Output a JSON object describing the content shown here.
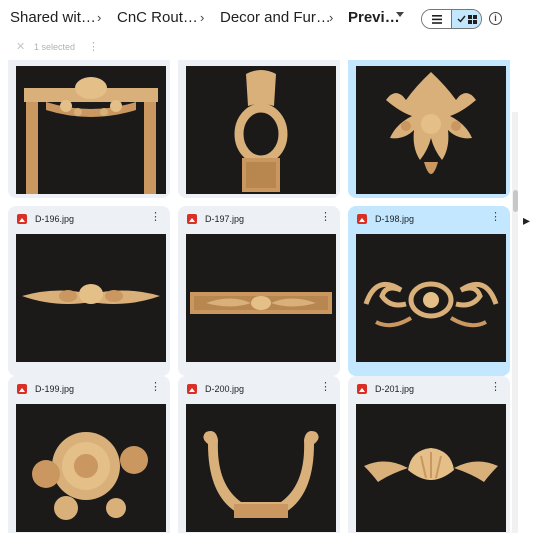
{
  "breadcrumb": {
    "items": [
      "Shared wit…",
      "CnC Rout…",
      "Decor and Fur…"
    ],
    "current": "Previ…",
    "separator": "›"
  },
  "toolbar": {
    "list_view_icon": "list-icon",
    "grid_view_icon": "grid-icon",
    "check_icon": "check-icon",
    "info_icon": "info-icon",
    "info_glyph": "i"
  },
  "selection_bar": {
    "close_glyph": "✕",
    "count_label": "1 selected",
    "more_glyph": "⋮"
  },
  "files": [
    {
      "name": "",
      "selected": false,
      "art": "arch"
    },
    {
      "name": "",
      "selected": false,
      "art": "mirror"
    },
    {
      "name": "",
      "selected": true,
      "art": "medallion"
    },
    {
      "name": "D-196.jpg",
      "selected": false,
      "art": "swag"
    },
    {
      "name": "D-197.jpg",
      "selected": false,
      "art": "panel"
    },
    {
      "name": "D-198.jpg",
      "selected": true,
      "art": "scroll"
    },
    {
      "name": "D-199.jpg",
      "selected": false,
      "art": "roses"
    },
    {
      "name": "D-200.jpg",
      "selected": false,
      "art": "handle"
    },
    {
      "name": "D-201.jpg",
      "selected": false,
      "art": "shell"
    }
  ],
  "colors": {
    "card_bg": "#edf0f5",
    "card_selected_bg": "#c2e7ff",
    "image_icon": "#d93025",
    "thumb_bg": "#1b1a19",
    "carving": "#d9b07a"
  }
}
